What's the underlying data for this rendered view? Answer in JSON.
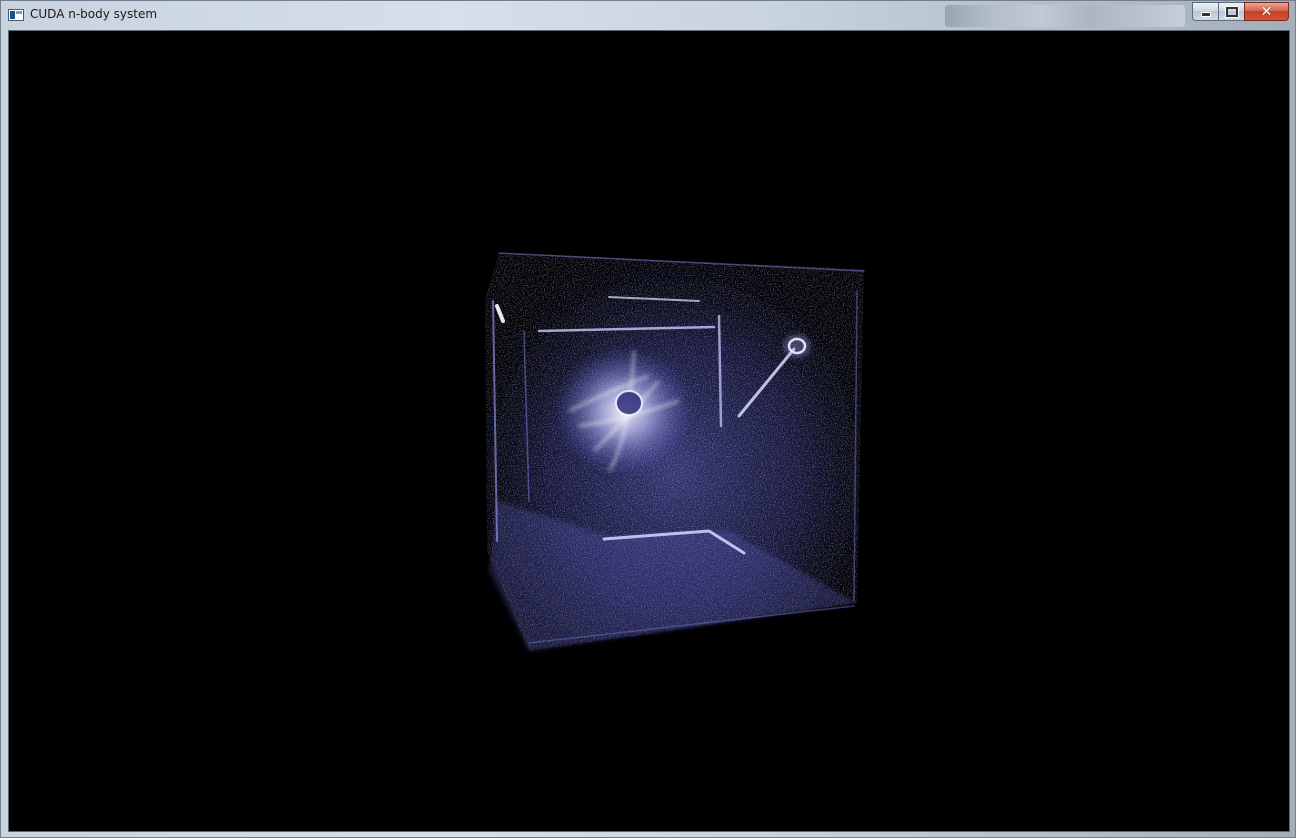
{
  "window": {
    "title": "CUDA n-body system",
    "close_symbol": "✕"
  },
  "viewport": {
    "scene": "n-body particle simulation rendered as glowing points",
    "particle_color": "#8a8cff",
    "background_color": "#000000"
  },
  "icons": {
    "app": "window-app-icon",
    "minimize": "minimize-icon",
    "maximize": "maximize-icon",
    "close": "close-icon"
  }
}
